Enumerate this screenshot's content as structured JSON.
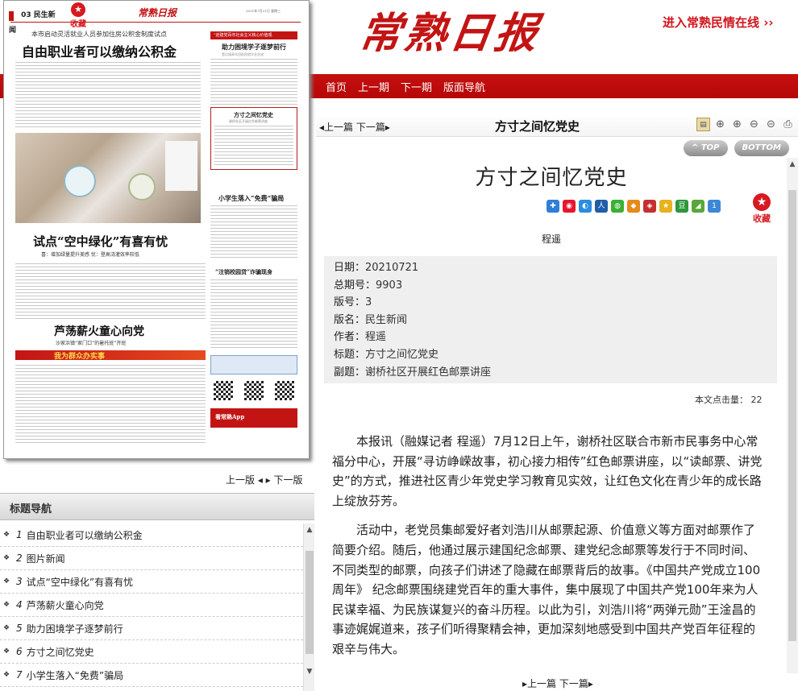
{
  "header": {
    "logo_text": "常熟日报",
    "enter_link": "进入常熟民情在线 ››",
    "nav": [
      "首页",
      "上一期",
      "下一期",
      "版面导航"
    ]
  },
  "paper": {
    "section_label": "03 民生新闻",
    "collect_label": "收藏",
    "masthead": "常熟日报",
    "date_line": "2021年7月21日 星期三",
    "lead_kicker": "本市启动灵活就业人员参加住房公积金制度试点",
    "lead_headline": "自由职业者可以缴纳公积金",
    "sidebar_box_title": "“迎建党百年社会主义核心价值观",
    "sidebar_headline_1": "助力困境学子逐梦前行",
    "sidebar_sub_1": "董浜镇青年团助困就学金发放",
    "sidebar_headline_2": "方寸之间忆党史",
    "sidebar_sub_2": "谢桥社区开展红色邮票讲座",
    "headline_3": "试点“空中绿化”有喜有忧",
    "headline_3_sub": "喜：增加绿量提升美感  忧：登高浇灌效率较低",
    "sidebar_headline_4": "小学生落入“免费”骗局",
    "headline_5": "芦荡薪火童心向党",
    "headline_5_sub": "沙家浜镇“家门口”的暑托班”开班",
    "sidebar_headline_6": "“注销校园贷”诈骗现身",
    "bottom_banner": "我为群众办实事",
    "app_label": "看常熟App",
    "prev_next": [
      "上一版 ◂",
      " ▸ 下一版"
    ]
  },
  "title_nav": {
    "header": "标题导航",
    "items": [
      {
        "num": "1",
        "title": "自由职业者可以缴纳公积金"
      },
      {
        "num": "2",
        "title": "图片新闻"
      },
      {
        "num": "3",
        "title": "试点“空中绿化”有喜有忧"
      },
      {
        "num": "4",
        "title": "芦荡薪火童心向党"
      },
      {
        "num": "5",
        "title": "助力困境学子逐梦前行"
      },
      {
        "num": "6",
        "title": "方寸之间忆党史"
      },
      {
        "num": "7",
        "title": "小学生落入“免费”骗局"
      }
    ]
  },
  "toolbar": {
    "prev": "◂上一篇",
    "next": "下一篇▸",
    "title": "方寸之间忆党史",
    "top_btn": "^ TOP",
    "bottom_btn": "BOTTOM"
  },
  "article": {
    "title": "方寸之间忆党史",
    "collect": "收藏",
    "author": "程遥",
    "meta": [
      {
        "k": "日期：",
        "v": "20210721"
      },
      {
        "k": "总期号：",
        "v": "9903"
      },
      {
        "k": "版号：",
        "v": "3"
      },
      {
        "k": "版名：",
        "v": "民生新闻"
      },
      {
        "k": "作者：",
        "v": "程遥"
      },
      {
        "k": "标题：",
        "v": "方寸之间忆党史"
      },
      {
        "k": "副题：",
        "v": "谢桥社区开展红色邮票讲座"
      }
    ],
    "clicks": "本文点击量： 22",
    "paragraphs": [
      "本报讯（融媒记者 程遥）7月12日上午，谢桥社区联合市新市民事务中心常福分中心，开展“寻访峥嵘故事，初心接力相传”红色邮票讲座，以“读邮票、讲党史”的方式，推进社区青少年党史学习教育见实效，让红色文化在青少年的成长路上绽放芬芳。",
      "活动中，老党员集邮爱好者刘浩川从邮票起源、价值意义等方面对邮票作了简要介绍。随后，他通过展示建国纪念邮票、建党纪念邮票等发行于不同时间、不同类型的邮票，向孩子们讲述了隐藏在邮票背后的故事。《中国共产党成立100周年》 纪念邮票围绕建党百年的重大事件，集中展现了中国共产党100年来为人民谋幸福、为民族谋复兴的奋斗历程。以此为引，刘浩川将“两弹元勋”王淦昌的事迹娓娓道来，孩子们听得聚精会神，更加深刻地感受到中国共产党百年征程的艰辛与伟大。"
    ]
  },
  "bottom_nav": "▸上一篇 下一篇▸",
  "colors": {
    "brand_red": "#c31414",
    "nav_bar": "#c00d0d",
    "collect_red": "#d71920"
  }
}
